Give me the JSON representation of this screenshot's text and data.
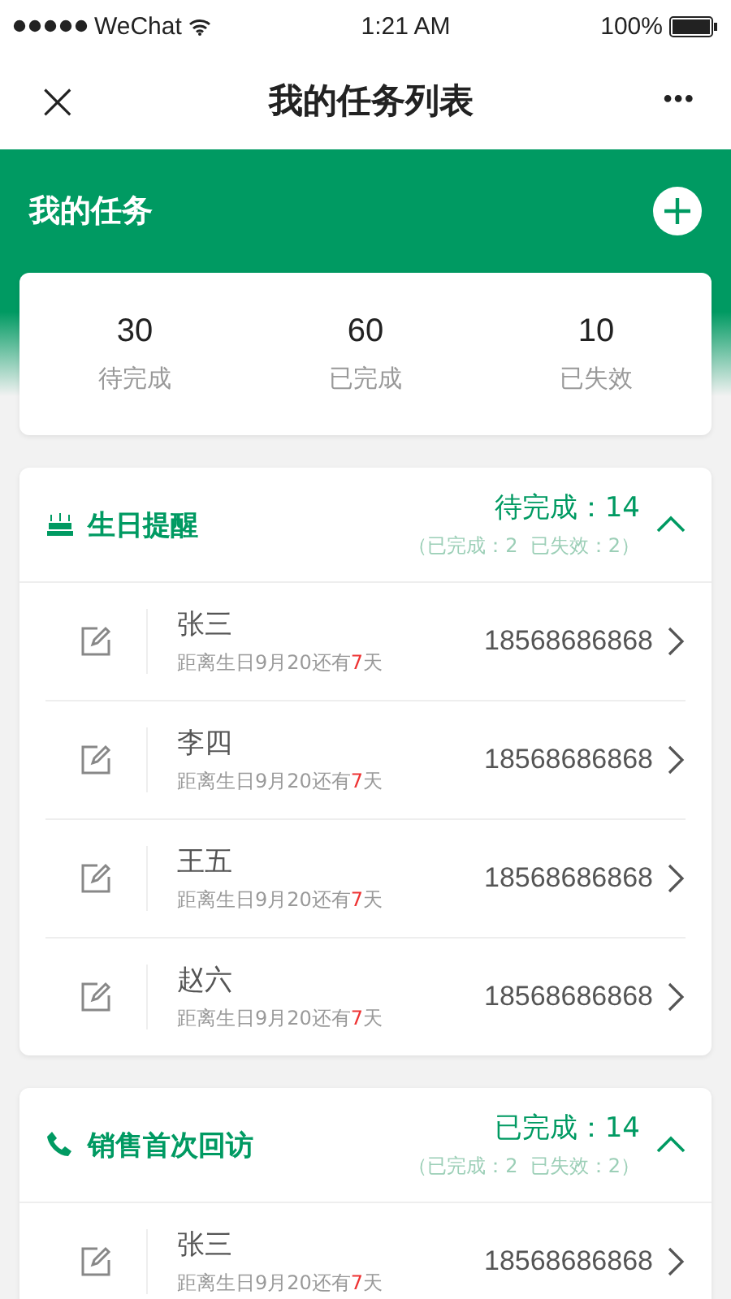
{
  "status_bar": {
    "carrier": "WeChat",
    "time": "1:21 AM",
    "battery": "100%"
  },
  "nav": {
    "close": "×",
    "title": "我的任务列表",
    "more": "•••"
  },
  "header": {
    "title": "我的任务"
  },
  "stats": [
    {
      "value": "30",
      "label": "待完成"
    },
    {
      "value": "60",
      "label": "已完成"
    },
    {
      "value": "10",
      "label": "已失效"
    }
  ],
  "groups": [
    {
      "kind": "birthday",
      "title": "生日提醒",
      "count": "待完成：14",
      "detail": "（已完成：2  已失效：2）",
      "expanded": true,
      "items": [
        {
          "name": "张三",
          "note_prefix": "距离生日9月20还有",
          "days": "7",
          "note_suffix": "天",
          "phone": "18568686868"
        },
        {
          "name": "李四",
          "note_prefix": "距离生日9月20还有",
          "days": "7",
          "note_suffix": "天",
          "phone": "18568686868"
        },
        {
          "name": "王五",
          "note_prefix": "距离生日9月20还有",
          "days": "7",
          "note_suffix": "天",
          "phone": "18568686868"
        },
        {
          "name": "赵六",
          "note_prefix": "距离生日9月20还有",
          "days": "7",
          "note_suffix": "天",
          "phone": "18568686868"
        }
      ]
    },
    {
      "kind": "call",
      "title": "销售首次回访",
      "count": "已完成：14",
      "detail": "（已完成：2  已失效：2）",
      "expanded": true,
      "items": [
        {
          "name": "张三",
          "note_prefix": "距离生日9月20还有",
          "days": "7",
          "note_suffix": "天",
          "phone": "18568686868"
        }
      ]
    }
  ]
}
